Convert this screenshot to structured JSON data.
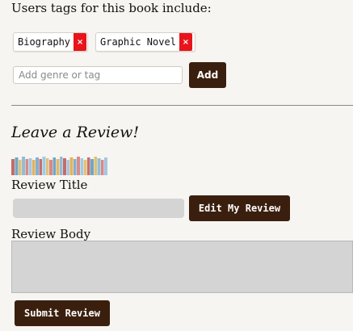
{
  "tags_section": {
    "heading": "Users tags for this book include:",
    "tags": [
      {
        "label": "Biography",
        "remove": "×"
      },
      {
        "label": "Graphic Novel",
        "remove": "×"
      }
    ],
    "genre_input_placeholder": "Add genre or tag",
    "add_button": "Add"
  },
  "review_section": {
    "heading": "Leave a Review!",
    "title_label": "Review Title",
    "edit_button": "Edit My Review",
    "body_label": "Review Body",
    "submit_button": "Submit Review"
  },
  "colors": {
    "button_bg": "#3b1f0e",
    "remove_bg": "#e8141b",
    "input_gray": "#d4d4d4",
    "page_bg": "#f7f5f1"
  }
}
